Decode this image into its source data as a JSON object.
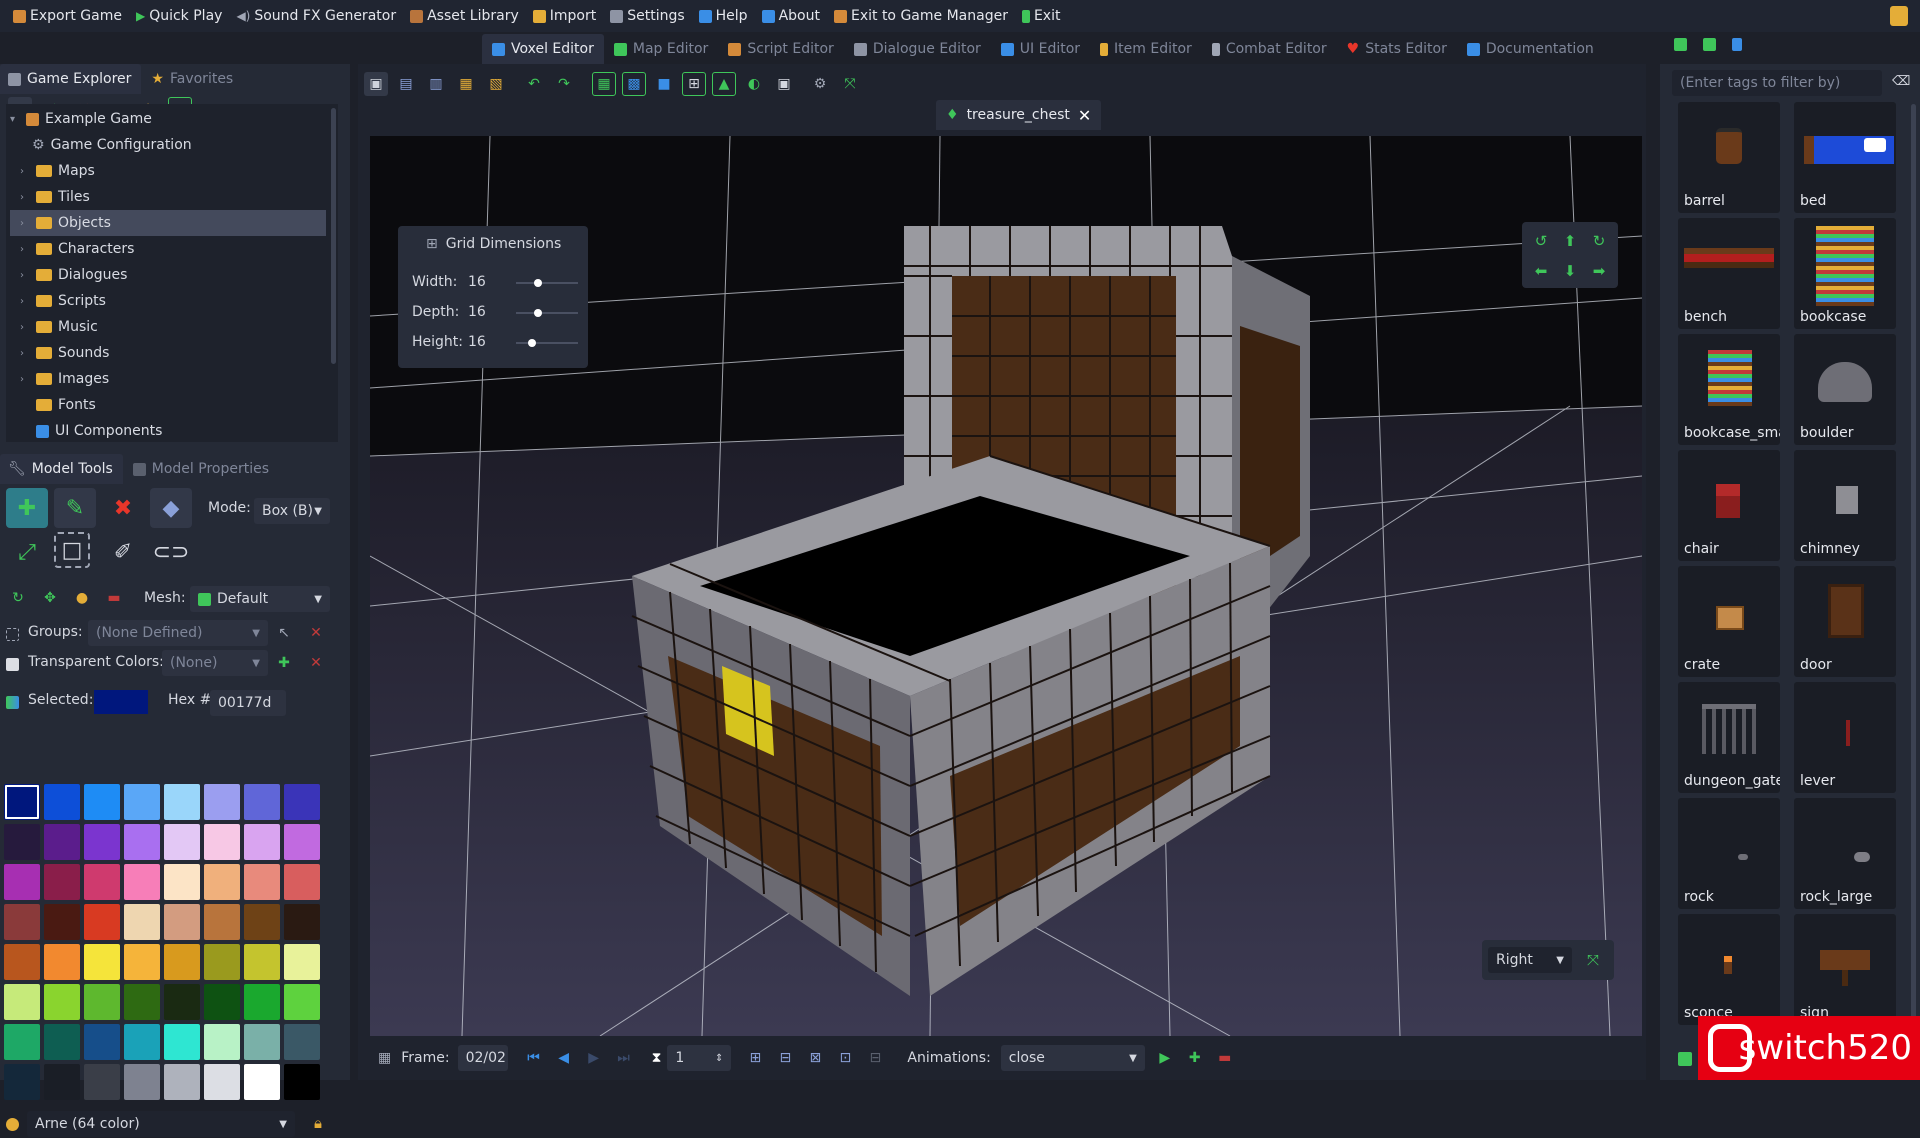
{
  "menubar": {
    "items": [
      {
        "label": "Export Game",
        "icon": "export-icon",
        "color": "#d48a3a"
      },
      {
        "label": "Quick Play",
        "icon": "play-icon",
        "color": "#3fc65a"
      },
      {
        "label": "Sound FX Generator",
        "icon": "speaker-icon",
        "color": "#a0a6b5"
      },
      {
        "label": "Asset Library",
        "icon": "library-icon",
        "color": "#d48a3a"
      },
      {
        "label": "Import",
        "icon": "import-icon",
        "color": "#e4ad38"
      },
      {
        "label": "Settings",
        "icon": "settings-icon",
        "color": "#a0a6b5"
      },
      {
        "label": "Help",
        "icon": "help-icon",
        "color": "#3a8ee6"
      },
      {
        "label": "About",
        "icon": "info-icon",
        "color": "#3a8ee6"
      },
      {
        "label": "Exit to Game Manager",
        "icon": "manager-icon",
        "color": "#d48a3a"
      },
      {
        "label": "Exit",
        "icon": "exit-icon",
        "color": "#3fc65a"
      }
    ]
  },
  "left_tabs": {
    "explorer": "Game Explorer",
    "favorites": "Favorites"
  },
  "tree": {
    "root": "Example Game",
    "items": [
      {
        "label": "Game Configuration",
        "kind": "gear",
        "expandable": false
      },
      {
        "label": "Maps",
        "kind": "folder",
        "expandable": true
      },
      {
        "label": "Tiles",
        "kind": "folder",
        "expandable": true
      },
      {
        "label": "Objects",
        "kind": "folder",
        "expandable": true,
        "selected": true
      },
      {
        "label": "Characters",
        "kind": "folder",
        "expandable": true
      },
      {
        "label": "Dialogues",
        "kind": "folder",
        "expandable": true
      },
      {
        "label": "Scripts",
        "kind": "folder",
        "expandable": true
      },
      {
        "label": "Music",
        "kind": "folder",
        "expandable": true
      },
      {
        "label": "Sounds",
        "kind": "folder",
        "expandable": true
      },
      {
        "label": "Images",
        "kind": "folder",
        "expandable": true
      },
      {
        "label": "Fonts",
        "kind": "folder",
        "expandable": false
      },
      {
        "label": "UI Components",
        "kind": "ui",
        "expandable": false
      }
    ]
  },
  "model_tabs": {
    "tools": "Model Tools",
    "properties": "Model Properties"
  },
  "model_tools": {
    "mode_label": "Mode:",
    "mode_value": "Box (B)",
    "mesh_label": "Mesh:",
    "mesh_value": "Default",
    "groups_label": "Groups:",
    "groups_value": "(None Defined)",
    "transparent_label": "Transparent Colors:",
    "transparent_value": "(None)",
    "selected_label": "Selected:",
    "selected_color": "#00177d",
    "hex_label": "Hex #:",
    "hex_value": "00177d",
    "palette_name": "Arne (64 color)"
  },
  "palette": [
    "#00177d",
    "#0d4fd8",
    "#1e8cf5",
    "#5aa7f7",
    "#9ad6fa",
    "#9b9ef0",
    "#6066d8",
    "#3a34b8",
    "#261a3d",
    "#5b1d8c",
    "#7b35cf",
    "#a96ff0",
    "#e3c8f5",
    "#f7c8e5",
    "#d9a4f0",
    "#c16ae0",
    "#a72fb2",
    "#8a1e4a",
    "#cf3a6e",
    "#f77eb8",
    "#fce4c6",
    "#f0b07c",
    "#e88a7c",
    "#d85e5e",
    "#8a3a3a",
    "#4a1a12",
    "#d83a22",
    "#eed6b0",
    "#d39c80",
    "#b8743c",
    "#6e4216",
    "#2a1a12",
    "#b8561e",
    "#f2892f",
    "#f5e43a",
    "#f5b43a",
    "#d89a1e",
    "#9a9a1e",
    "#c4c42e",
    "#e8f29a",
    "#c6ea7a",
    "#8ad42e",
    "#5eb82e",
    "#2e6a12",
    "#1a2a12",
    "#0e5212",
    "#1aa82e",
    "#5ed23e",
    "#1ea866",
    "#0e5e52",
    "#164e8a",
    "#1aa2b8",
    "#2ee6d2",
    "#b8f2c6",
    "#7ab0a8",
    "#3a5866",
    "#14283a",
    "#1a1e26",
    "#3a3e48",
    "#7e8290",
    "#aeb2bc",
    "#dcdee4",
    "#ffffff",
    "#000000"
  ],
  "editor_tabs": [
    {
      "label": "Voxel Editor",
      "active": true
    },
    {
      "label": "Map Editor",
      "active": false
    },
    {
      "label": "Script Editor",
      "active": false
    },
    {
      "label": "Dialogue Editor",
      "active": false
    },
    {
      "label": "UI Editor",
      "active": false
    },
    {
      "label": "Item Editor",
      "active": false
    },
    {
      "label": "Combat Editor",
      "active": false
    },
    {
      "label": "Stats Editor",
      "active": false
    },
    {
      "label": "Documentation",
      "active": false
    }
  ],
  "document": {
    "tab_name": "treasure_chest"
  },
  "grid_dimensions": {
    "title": "Grid Dimensions",
    "rows": [
      {
        "label": "Width:",
        "value": "16",
        "level": 0.35
      },
      {
        "label": "Depth:",
        "value": "16",
        "level": 0.35
      },
      {
        "label": "Height:",
        "value": "16",
        "level": 0.25
      }
    ]
  },
  "view_select": {
    "value": "Right"
  },
  "frame_bar": {
    "frame_label": "Frame:",
    "frame_value": "02/02",
    "speed_value": "1",
    "animations_label": "Animations:",
    "animation_value": "close"
  },
  "asset_library": {
    "filter_placeholder": "(Enter tags to filter by)",
    "assets": [
      {
        "label": "barrel",
        "icon": "barrel-icon"
      },
      {
        "label": "bed",
        "icon": "bed-icon"
      },
      {
        "label": "bench",
        "icon": "bench-icon"
      },
      {
        "label": "bookcase",
        "icon": "bookcase-icon"
      },
      {
        "label": "bookcase_sma",
        "icon": "bookcase-small-icon"
      },
      {
        "label": "boulder",
        "icon": "boulder-icon"
      },
      {
        "label": "chair",
        "icon": "chair-icon"
      },
      {
        "label": "chimney",
        "icon": "chimney-icon"
      },
      {
        "label": "crate",
        "icon": "crate-icon"
      },
      {
        "label": "door",
        "icon": "door-icon"
      },
      {
        "label": "dungeon_gate",
        "icon": "gate-icon"
      },
      {
        "label": "lever",
        "icon": "lever-icon"
      },
      {
        "label": "rock",
        "icon": "rock-icon"
      },
      {
        "label": "rock_large",
        "icon": "rock-large-icon"
      },
      {
        "label": "sconce",
        "icon": "sconce-icon"
      },
      {
        "label": "sign",
        "icon": "sign-icon"
      }
    ]
  },
  "watermark": {
    "text": "switch520"
  }
}
